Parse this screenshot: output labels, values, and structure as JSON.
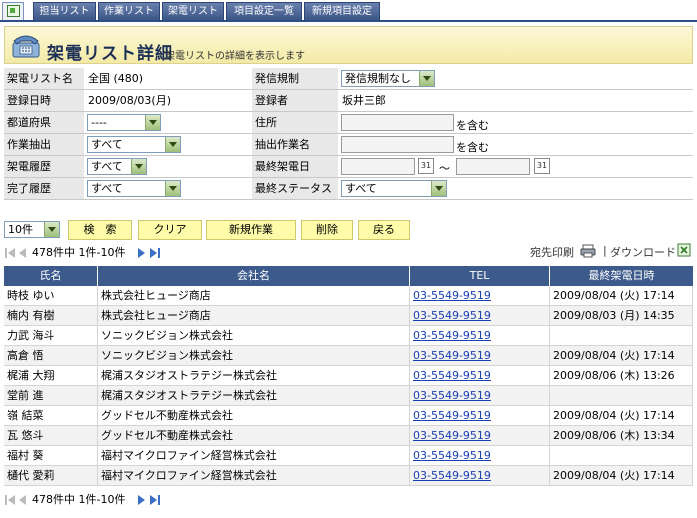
{
  "tabs": [
    "担当リスト",
    "作業リスト",
    "架電リスト",
    "項目設定一覧",
    "新規項目設定"
  ],
  "header": {
    "title": "架電リスト詳細",
    "subtitle": "架電リストの詳細を表示します"
  },
  "form": {
    "list_name_label": "架電リスト名",
    "list_name_value": "全国 (480)",
    "call_restrict_label": "発信規制",
    "call_restrict_value": "発信規制なし",
    "reg_date_label": "登録日時",
    "reg_date_value": "2009/08/03(月)",
    "registrant_label": "登録者",
    "registrant_value": "坂井三郎",
    "pref_label": "都道府県",
    "pref_value": "----",
    "address_label": "住所",
    "address_suffix": "を含む",
    "task_extract_label": "作業抽出",
    "task_extract_value": "すべて",
    "extract_task_name_label": "抽出作業名",
    "extract_task_name_suffix": "を含む",
    "call_history_label": "架電履歴",
    "call_history_value": "すべて",
    "last_call_label": "最終架電日",
    "range_sep": "〜",
    "cal_text": "31",
    "done_history_label": "完了履歴",
    "done_history_value": "すべて",
    "last_status_label": "最終ステータス",
    "last_status_value": "すべて"
  },
  "buttons": {
    "per_page": "10件",
    "search": "検　索",
    "clear": "クリア",
    "new_task": "新規作業",
    "delete": "削除",
    "back": "戻る"
  },
  "pager": {
    "summary": "478件中  1件-10件"
  },
  "links": {
    "print": "宛先印刷",
    "separator": "|",
    "download": "ダウンロード"
  },
  "table": {
    "headers": [
      "氏名",
      "会社名",
      "TEL",
      "最終架電日時"
    ],
    "rows": [
      [
        "時枝 ゆい",
        "株式会社ヒュージ商店",
        "03-5549-9519",
        "2009/08/04 (火) 17:14"
      ],
      [
        "楠内 有樹",
        "株式会社ヒュージ商店",
        "03-5549-9519",
        "2009/08/03 (月) 14:35"
      ],
      [
        "力武 海斗",
        "ソニックビジョン株式会社",
        "03-5549-9519",
        ""
      ],
      [
        "高倉 悟",
        "ソニックビジョン株式会社",
        "03-5549-9519",
        "2009/08/04 (火) 17:14"
      ],
      [
        "梶浦 大翔",
        "梶浦スタジオストラテジー株式会社",
        "03-5549-9519",
        "2009/08/06 (木) 13:26"
      ],
      [
        "堂前 進",
        "梶浦スタジオストラテジー株式会社",
        "03-5549-9519",
        ""
      ],
      [
        "嶺 結菜",
        "グッドセル不動産株式会社",
        "03-5549-9519",
        "2009/08/04 (火) 17:14"
      ],
      [
        "瓦 悠斗",
        "グッドセル不動産株式会社",
        "03-5549-9519",
        "2009/08/06 (木) 13:34"
      ],
      [
        "福村 葵",
        "福村マイクロファイン経営株式会社",
        "03-5549-9519",
        ""
      ],
      [
        "樋代 愛莉",
        "福村マイクロファイン経営株式会社",
        "03-5549-9519",
        "2009/08/04 (火) 17:14"
      ]
    ]
  },
  "colors": {
    "tab_bg": "#3b5687",
    "header_bg": "#f3eaa6",
    "table_head": "#3d5a8c",
    "button_bg": "#fefca8",
    "link": "#1a3fb4"
  }
}
